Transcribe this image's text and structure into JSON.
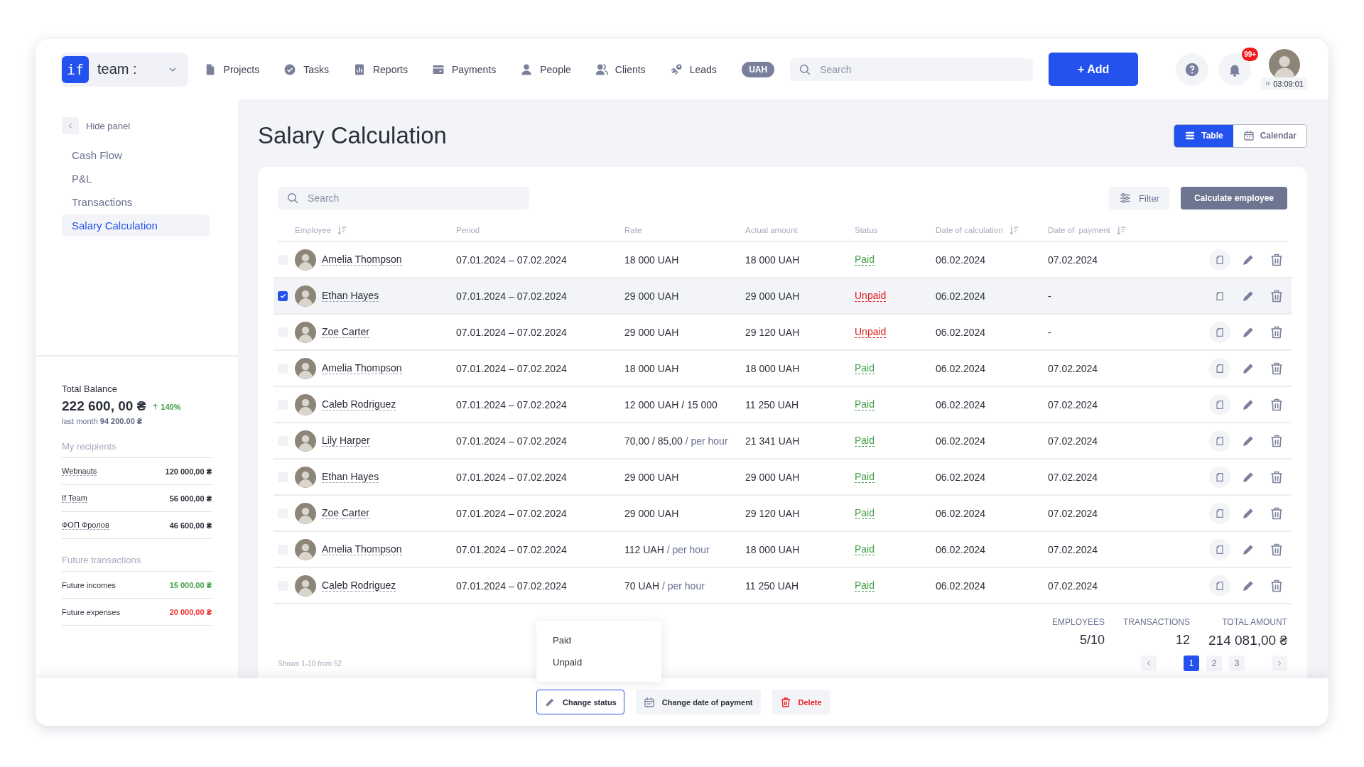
{
  "header": {
    "logo_mark": "if",
    "workspace": "team :",
    "nav": [
      {
        "label": "Projects"
      },
      {
        "label": "Tasks"
      },
      {
        "label": "Reports"
      },
      {
        "label": "Payments"
      },
      {
        "label": "People"
      },
      {
        "label": "Clients"
      },
      {
        "label": "Leads"
      }
    ],
    "currency": "UAH",
    "search": {
      "placeholder": "Search"
    },
    "add_button": "+ Add",
    "notification_badge": "99+",
    "timer": "03:09:01"
  },
  "sidebar": {
    "hide_label": "Hide panel",
    "items": [
      {
        "label": "Cash Flow",
        "selected": false
      },
      {
        "label": "P&L",
        "selected": false
      },
      {
        "label": "Transactions",
        "selected": false
      },
      {
        "label": "Salary Calculation",
        "selected": true
      }
    ],
    "balance": {
      "title": "Total Balance",
      "amount": "222 600, 00 ₴",
      "change": "140%",
      "last_month_label": "last month",
      "last_month_value": "94 200.00 ₴"
    },
    "recipients": {
      "title": "My recipients",
      "rows": [
        {
          "name": "Webnauts",
          "amount": "120 000,00 ₴"
        },
        {
          "name": "If Team",
          "amount": "56 000,00 ₴"
        },
        {
          "name": "ФОП Фролов",
          "amount": "46 600,00 ₴"
        }
      ]
    },
    "future": {
      "title": "Future transactions",
      "rows": [
        {
          "label": "Future incomes",
          "amount": "15 000.00 ₴",
          "kind": "income"
        },
        {
          "label": "Future expenses",
          "amount": "20 000,00 ₴",
          "kind": "expense"
        }
      ]
    }
  },
  "page": {
    "title": "Salary Calculation",
    "views": [
      {
        "label": "Table",
        "selected": true
      },
      {
        "label": "Calendar",
        "selected": false
      }
    ]
  },
  "toolbar": {
    "search": {
      "placeholder": "Search"
    },
    "filter": "Filter",
    "calculate": "Calculate employee"
  },
  "table": {
    "columns": [
      {
        "label": "Employee",
        "sortable": true
      },
      {
        "label": "Period",
        "sortable": false
      },
      {
        "label": "Rate",
        "sortable": false
      },
      {
        "label": "Actual amount",
        "sortable": false
      },
      {
        "label": "Status",
        "sortable": false
      },
      {
        "label": "Date of calculation",
        "sortable": true
      },
      {
        "label": "Date of  payment",
        "sortable": true
      }
    ],
    "rows": [
      {
        "checked": false,
        "employee": "Amelia Thompson",
        "period": "07.01.2024 – 07.02.2024",
        "rate": "18 000 UAH",
        "actual": "18 000 UAH",
        "status": "Paid",
        "paid": true,
        "date_calc": "06.02.2024",
        "date_pay": "07.02.2024"
      },
      {
        "checked": true,
        "employee": "Ethan Hayes",
        "period": "07.01.2024 – 07.02.2024",
        "rate": "29 000 UAH",
        "actual": "29 000 UAH",
        "status": "Unpaid",
        "paid": false,
        "date_calc": "06.02.2024",
        "date_pay": "-"
      },
      {
        "checked": false,
        "employee": "Zoe Carter",
        "period": "07.01.2024 – 07.02.2024",
        "rate": "29 000 UAH",
        "actual": "29 120 UAH",
        "status": "Unpaid",
        "paid": false,
        "date_calc": "06.02.2024",
        "date_pay": "-"
      },
      {
        "checked": false,
        "employee": "Amelia Thompson",
        "period": "07.01.2024 – 07.02.2024",
        "rate": "18 000 UAH",
        "actual": "18 000 UAH",
        "status": "Paid",
        "paid": true,
        "date_calc": "06.02.2024",
        "date_pay": "07.02.2024"
      },
      {
        "checked": false,
        "employee": "Caleb Rodriguez",
        "period": "07.01.2024 – 07.02.2024",
        "rate": "12 000 UAH / 15 000",
        "actual": "11 250 UAH",
        "status": "Paid",
        "paid": true,
        "date_calc": "06.02.2024",
        "date_pay": "07.02.2024"
      },
      {
        "checked": false,
        "employee": "Lily Harper",
        "period": "07.01.2024 – 07.02.2024",
        "rate": "70,00 / 85,00",
        "rate_unit": "/ per hour",
        "actual": "21 341 UAH",
        "status": "Paid",
        "paid": true,
        "date_calc": "06.02.2024",
        "date_pay": "07.02.2024"
      },
      {
        "checked": false,
        "employee": "Ethan Hayes",
        "period": "07.01.2024 – 07.02.2024",
        "rate": "29 000 UAH",
        "actual": "29 000 UAH",
        "status": "Paid",
        "paid": true,
        "date_calc": "06.02.2024",
        "date_pay": "07.02.2024"
      },
      {
        "checked": false,
        "employee": "Zoe Carter",
        "period": "07.01.2024 – 07.02.2024",
        "rate": "29 000 UAH",
        "actual": "29 120 UAH",
        "status": "Paid",
        "paid": true,
        "date_calc": "06.02.2024",
        "date_pay": "07.02.2024"
      },
      {
        "checked": false,
        "employee": "Amelia Thompson",
        "period": "07.01.2024 – 07.02.2024",
        "rate": "112 UAH",
        "rate_unit": "/ per hour",
        "actual": "18 000 UAH",
        "status": "Paid",
        "paid": true,
        "date_calc": "06.02.2024",
        "date_pay": "07.02.2024"
      },
      {
        "checked": false,
        "employee": "Caleb Rodriguez",
        "period": "07.01.2024 – 07.02.2024",
        "rate": "70 UAH",
        "rate_unit": "/ per hour",
        "actual": "11 250 UAH",
        "status": "Paid",
        "paid": true,
        "date_calc": "06.02.2024",
        "date_pay": "07.02.2024"
      }
    ]
  },
  "summary": [
    {
      "label": "EMPLOYEES",
      "value": "5/10"
    },
    {
      "label": "TRANSACTIONS",
      "value": "12"
    },
    {
      "label": "TOTAL AMOUNT",
      "value": "214 081,00 ₴"
    }
  ],
  "footer": {
    "shown": "Shown 1-10 from 52",
    "pages": [
      {
        "label": "1",
        "selected": true
      },
      {
        "label": "2",
        "selected": false
      },
      {
        "label": "3",
        "selected": false
      }
    ]
  },
  "status_menu": {
    "items": [
      "Paid",
      "Unpaid"
    ]
  },
  "actions": [
    {
      "label": "Change status",
      "kind": "edit",
      "selected": true
    },
    {
      "label": "Change date of payment",
      "kind": "calendar",
      "selected": false
    },
    {
      "label": "Delete",
      "kind": "delete",
      "selected": false
    }
  ]
}
